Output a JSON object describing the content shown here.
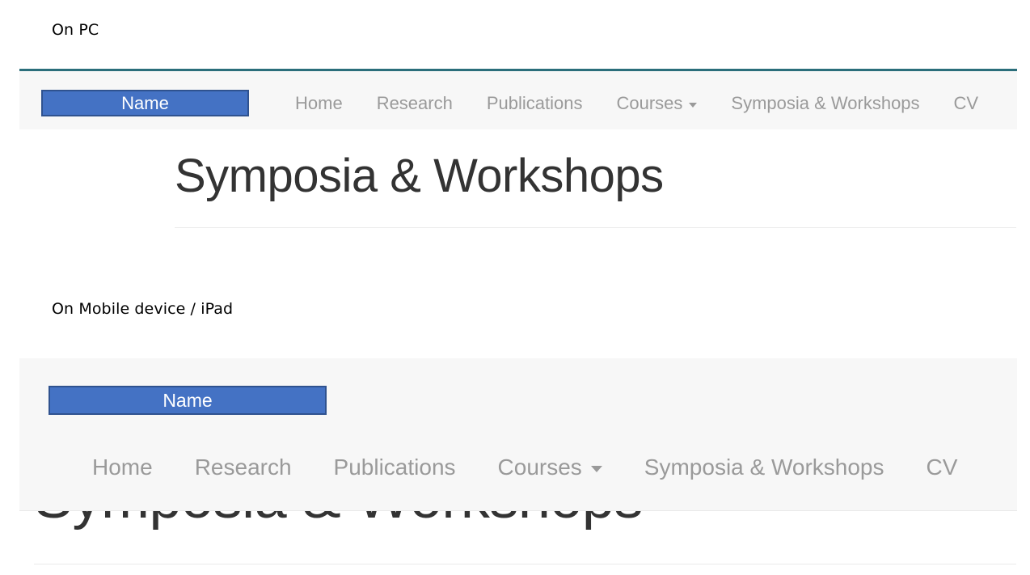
{
  "annotations": {
    "desktop_caption": "On PC",
    "mobile_caption": "On Mobile device / iPad"
  },
  "colors": {
    "navbar_background": "#f7f7f7",
    "navbar_top_border": "#2b6e7b",
    "brand_fill": "#4472c4",
    "brand_border": "#2f528f",
    "brand_text": "#ffffff",
    "nav_link_text": "#9a9a9a",
    "page_title_text": "#333333",
    "rule": "#ebebeb"
  },
  "desktop_navbar": {
    "brand_label": "Name",
    "links": [
      {
        "label": "Home",
        "has_caret": false
      },
      {
        "label": "Research",
        "has_caret": false
      },
      {
        "label": "Publications",
        "has_caret": false
      },
      {
        "label": "Courses",
        "has_caret": true
      },
      {
        "label": "Symposia & Workshops",
        "has_caret": false
      },
      {
        "label": "CV",
        "has_caret": false
      }
    ]
  },
  "mobile_navbar": {
    "brand_label": "Name",
    "links": [
      {
        "label": "Home",
        "has_caret": false
      },
      {
        "label": "Research",
        "has_caret": false
      },
      {
        "label": "Publications",
        "has_caret": false
      },
      {
        "label": "Courses",
        "has_caret": true
      },
      {
        "label": "Symposia & Workshops",
        "has_caret": false
      },
      {
        "label": "CV",
        "has_caret": false
      }
    ]
  },
  "desktop_page": {
    "title": "Symposia & Workshops"
  },
  "mobile_page": {
    "title": "Symposia & Workshops"
  }
}
